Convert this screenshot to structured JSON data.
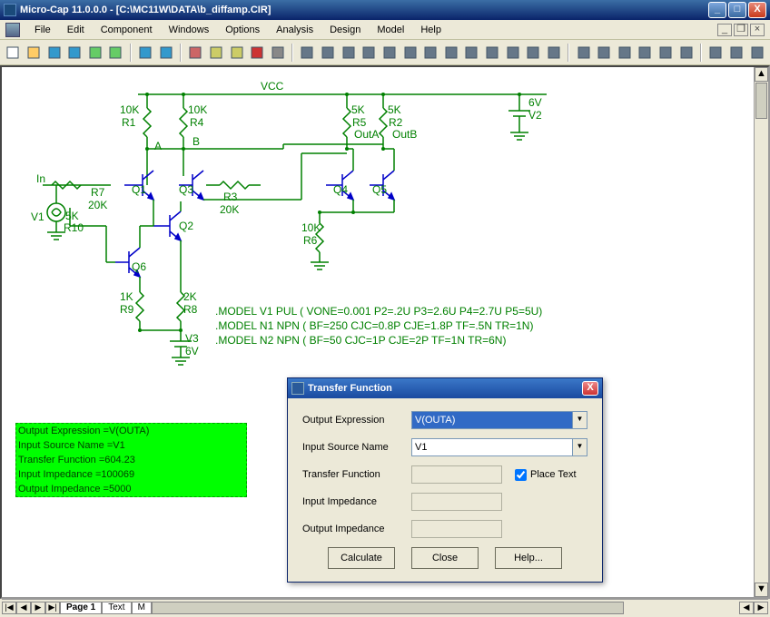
{
  "window": {
    "title": "Micro-Cap 11.0.0.0 - [C:\\MC11W\\DATA\\b_diffamp.CIR]",
    "min": "_",
    "max": "□",
    "close": "X"
  },
  "menu": [
    "File",
    "Edit",
    "Component",
    "Windows",
    "Options",
    "Analysis",
    "Design",
    "Model",
    "Help"
  ],
  "mdi": {
    "min": "_",
    "restore": "❐",
    "close": "×"
  },
  "toolbar_icons": [
    "new",
    "open",
    "save",
    "save-all",
    "schematic",
    "spreadsheet",
    "|",
    "undo",
    "redo",
    "|",
    "cut",
    "copy",
    "paste",
    "delete",
    "select-area",
    "|",
    "ground",
    "voltage-source",
    "capacitor",
    "resistor",
    "inductor",
    "diode",
    "mosfet",
    "op-amp",
    "nand",
    "transformer",
    "crystal",
    "lamp",
    "circle",
    "|",
    "tile-horiz",
    "tile-vert",
    "cascade",
    "window1",
    "window2",
    "zoom",
    "|",
    "globe",
    "plot",
    "help"
  ],
  "schematic": {
    "net_vcc": "VCC",
    "r1": {
      "val": "10K",
      "ref": "R1"
    },
    "r4": {
      "val": "10K",
      "ref": "R4"
    },
    "r5": {
      "val": "5K",
      "ref": "R5"
    },
    "r2": {
      "val": "5K",
      "ref": "R2"
    },
    "v2": {
      "val": "6V",
      "ref": "V2"
    },
    "outa": "OutA",
    "outb": "OutB",
    "node_a": "A",
    "node_b": "B",
    "node_in": "In",
    "r7": {
      "ref": "R7",
      "val": "20K"
    },
    "r10": {
      "ref": "R10",
      "val": "5K"
    },
    "v1": {
      "ref": "V1"
    },
    "q1": "Q1",
    "q2": "Q2",
    "q3": "Q3",
    "q4": "Q4",
    "q5": "Q5",
    "q6": "Q6",
    "r3": {
      "ref": "R3",
      "val": "20K"
    },
    "r6": {
      "ref": "R6",
      "val": "10K"
    },
    "r9": {
      "ref": "R9",
      "val": "1K"
    },
    "r8": {
      "ref": "R8",
      "val": "2K"
    },
    "v3": {
      "ref": "V3",
      "val": "6V"
    }
  },
  "model_text": [
    ".MODEL V1 PUL ( VONE=0.001 P2=.2U P3=2.6U P4=2.7U P5=5U)",
    ".MODEL N1 NPN ( BF=250 CJC=0.8P CJE=1.8P TF=.5N TR=1N)",
    ".MODEL N2 NPN ( BF=50 CJC=1P CJE=2P TF=1N TR=6N)"
  ],
  "results": {
    "l1": "Output Expression =V(OUTA)",
    "l2": "Input Source Name =V1",
    "l3": "Transfer Function =604.23",
    "l4": "Input Impedance =100069",
    "l5": "Output Impedance =5000"
  },
  "dialog": {
    "title": "Transfer Function",
    "out_expr_label": "Output Expression",
    "out_expr_value": "V(OUTA)",
    "in_src_label": "Input Source Name",
    "in_src_value": "V1",
    "tf_label": "Transfer Function",
    "place_text": "Place Text",
    "in_imp_label": "Input Impedance",
    "out_imp_label": "Output Impedance",
    "calc": "Calculate",
    "close": "Close",
    "help": "Help..."
  },
  "tabs": {
    "page1": "Page 1",
    "text": "Text",
    "m": "M"
  }
}
